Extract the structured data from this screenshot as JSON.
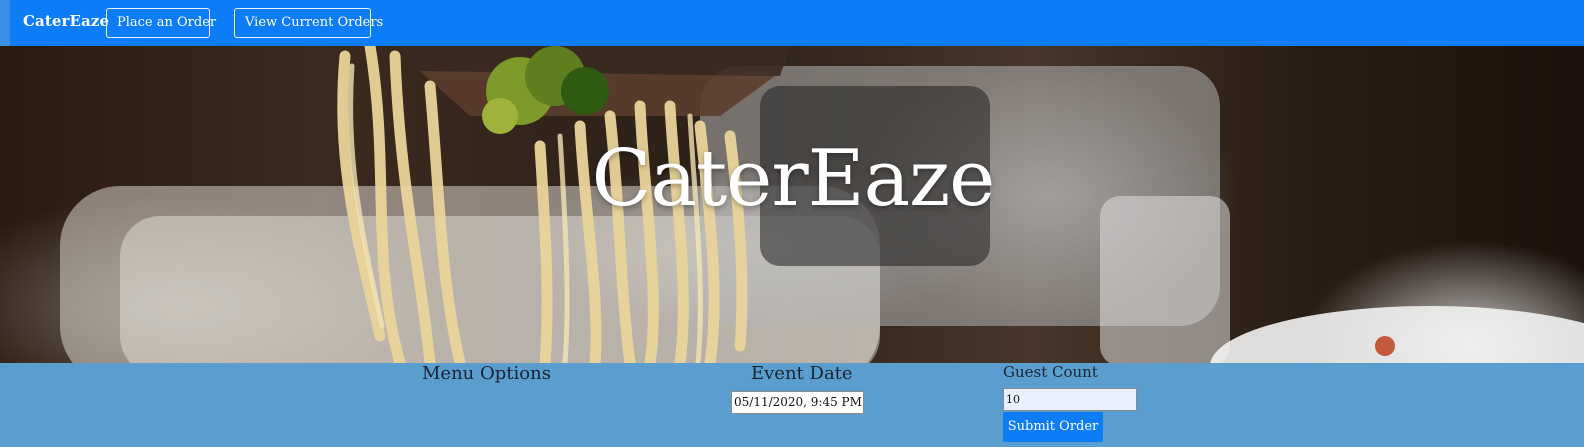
{
  "navbar": {
    "brand": "CaterEaze",
    "links": [
      {
        "label": "Place an Order"
      },
      {
        "label": "View Current Orders"
      }
    ]
  },
  "hero": {
    "title": "CaterEaze"
  },
  "order_form": {
    "menu_label": "Menu Options",
    "date_label": "Event Date",
    "date_value": "05/11/2020, 9:45 PM",
    "guest_label": "Guest Count",
    "guest_value": "10",
    "submit_label": "Submit Order"
  },
  "colors": {
    "navbar": "#0d7cf7",
    "order_bar": "#5a9ecf",
    "submit_button": "#0d7cf7"
  },
  "icons": {
    "hero_image": "pasta-on-fork-photo"
  }
}
